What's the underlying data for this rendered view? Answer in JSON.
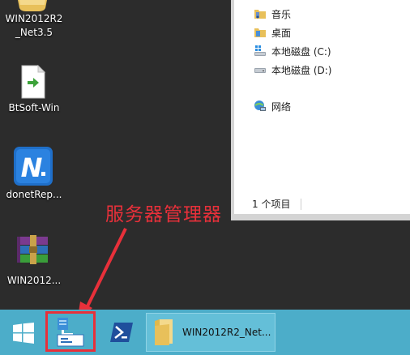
{
  "desktop": {
    "icons": [
      {
        "label": "WIN2012R2\n_Net3.5"
      },
      {
        "label": "BtSoft-Win"
      },
      {
        "label": "donetRep..."
      },
      {
        "label": "WIN2012..."
      }
    ]
  },
  "explorer": {
    "tree": [
      {
        "label": "音乐"
      },
      {
        "label": "桌面"
      },
      {
        "label": "本地磁盘 (C:)"
      },
      {
        "label": "本地磁盘 (D:)"
      },
      {
        "label": "网络"
      }
    ],
    "status": "1 个项目"
  },
  "annotation": {
    "text": "服务器管理器"
  },
  "taskbar": {
    "open_window": {
      "label": "WIN2012R2_Net..."
    }
  },
  "colors": {
    "taskbar": "#4cadc9",
    "annotation": "#e8303a",
    "desktop": "#2c2c2c"
  }
}
